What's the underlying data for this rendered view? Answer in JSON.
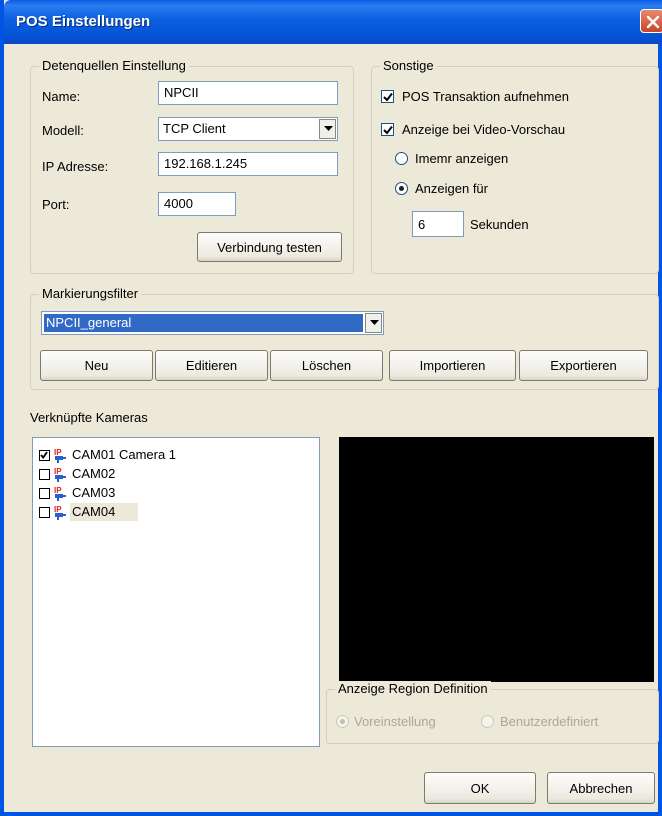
{
  "window": {
    "title": "POS Einstellungen"
  },
  "datasource": {
    "group_label": "Detenquellen Einstellung",
    "name_label": "Name:",
    "name_value": "NPCII",
    "model_label": "Modell:",
    "model_value": "TCP Client",
    "ip_label": "IP Adresse:",
    "ip_value": "192.168.1.245",
    "port_label": "Port:",
    "port_value": "4000",
    "test_button": "Verbindung testen"
  },
  "sonstige": {
    "group_label": "Sonstige",
    "pos_transaction": {
      "label": "POS Transaktion aufnehmen",
      "checked": true
    },
    "video_preview": {
      "label": "Anzeige bei Video-Vorschau",
      "checked": true
    },
    "always_show": {
      "label": "Imemr anzeigen",
      "selected": false
    },
    "show_for": {
      "label": "Anzeigen für",
      "selected": true
    },
    "seconds_value": "6",
    "seconds_label": "Sekunden"
  },
  "filter": {
    "group_label": "Markierungsfilter",
    "selected_value": "NPCII_general",
    "buttons": {
      "new": "Neu",
      "edit": "Editieren",
      "delete": "Löschen",
      "import": "Importieren",
      "export": "Exportieren"
    }
  },
  "cameras": {
    "section_label": "Verknüpfte Kameras",
    "items": [
      {
        "label": "CAM01 Camera 1",
        "checked": true
      },
      {
        "label": "CAM02",
        "checked": false
      },
      {
        "label": "CAM03",
        "checked": false
      },
      {
        "label": "CAM04",
        "checked": false
      }
    ]
  },
  "region": {
    "group_label": "Anzeige Region Definition",
    "default_option": "Voreinstellung",
    "custom_option": "Benutzerdefiniert"
  },
  "footer": {
    "ok": "OK",
    "cancel": "Abbrechen"
  },
  "colors": {
    "titlebar": "#0054e3",
    "dialog_bg": "#ece9d8",
    "selection": "#316ac5",
    "close_button": "#c9452b",
    "preview_bg": "#000000"
  },
  "icons": {
    "close": "close-icon",
    "dropdown": "chevron-down-icon",
    "camera": "ip-camera-icon"
  }
}
